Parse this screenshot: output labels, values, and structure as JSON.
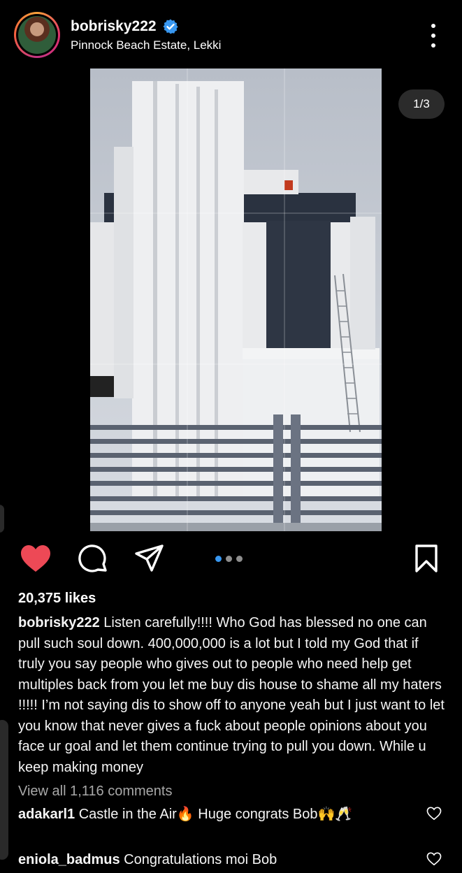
{
  "header": {
    "username": "bobrisky222",
    "location": "Pinnock Beach Estate, Lekki"
  },
  "media": {
    "counter": "1/3",
    "page_index": 1,
    "page_total": 3
  },
  "actions": {
    "liked": true,
    "like_color": "#ed4956",
    "active_dot_color": "#3897f0"
  },
  "post": {
    "likes": "20,375 likes",
    "caption_user": "bobrisky222",
    "caption_text": "Listen carefully!!!! Who God has blessed no one can pull such soul down. 400,000,000 is a lot but I told my God that if truly you say people who gives out to people who need help get multiples back from you let me buy dis house to shame all my haters !!!!! I’m not saying dis to show off to anyone yeah but I just want to let you know that never gives a fuck about people opinions about you face ur goal and let them continue trying to pull you down. While u keep making money",
    "view_comments": "View all 1,116 comments"
  },
  "comments": [
    {
      "user": "adakarl1",
      "text": "Castle in the Air🔥 Huge congrats Bob🙌🥂"
    },
    {
      "user": "eniola_badmus",
      "text": "Congratulations moi Bob"
    }
  ]
}
